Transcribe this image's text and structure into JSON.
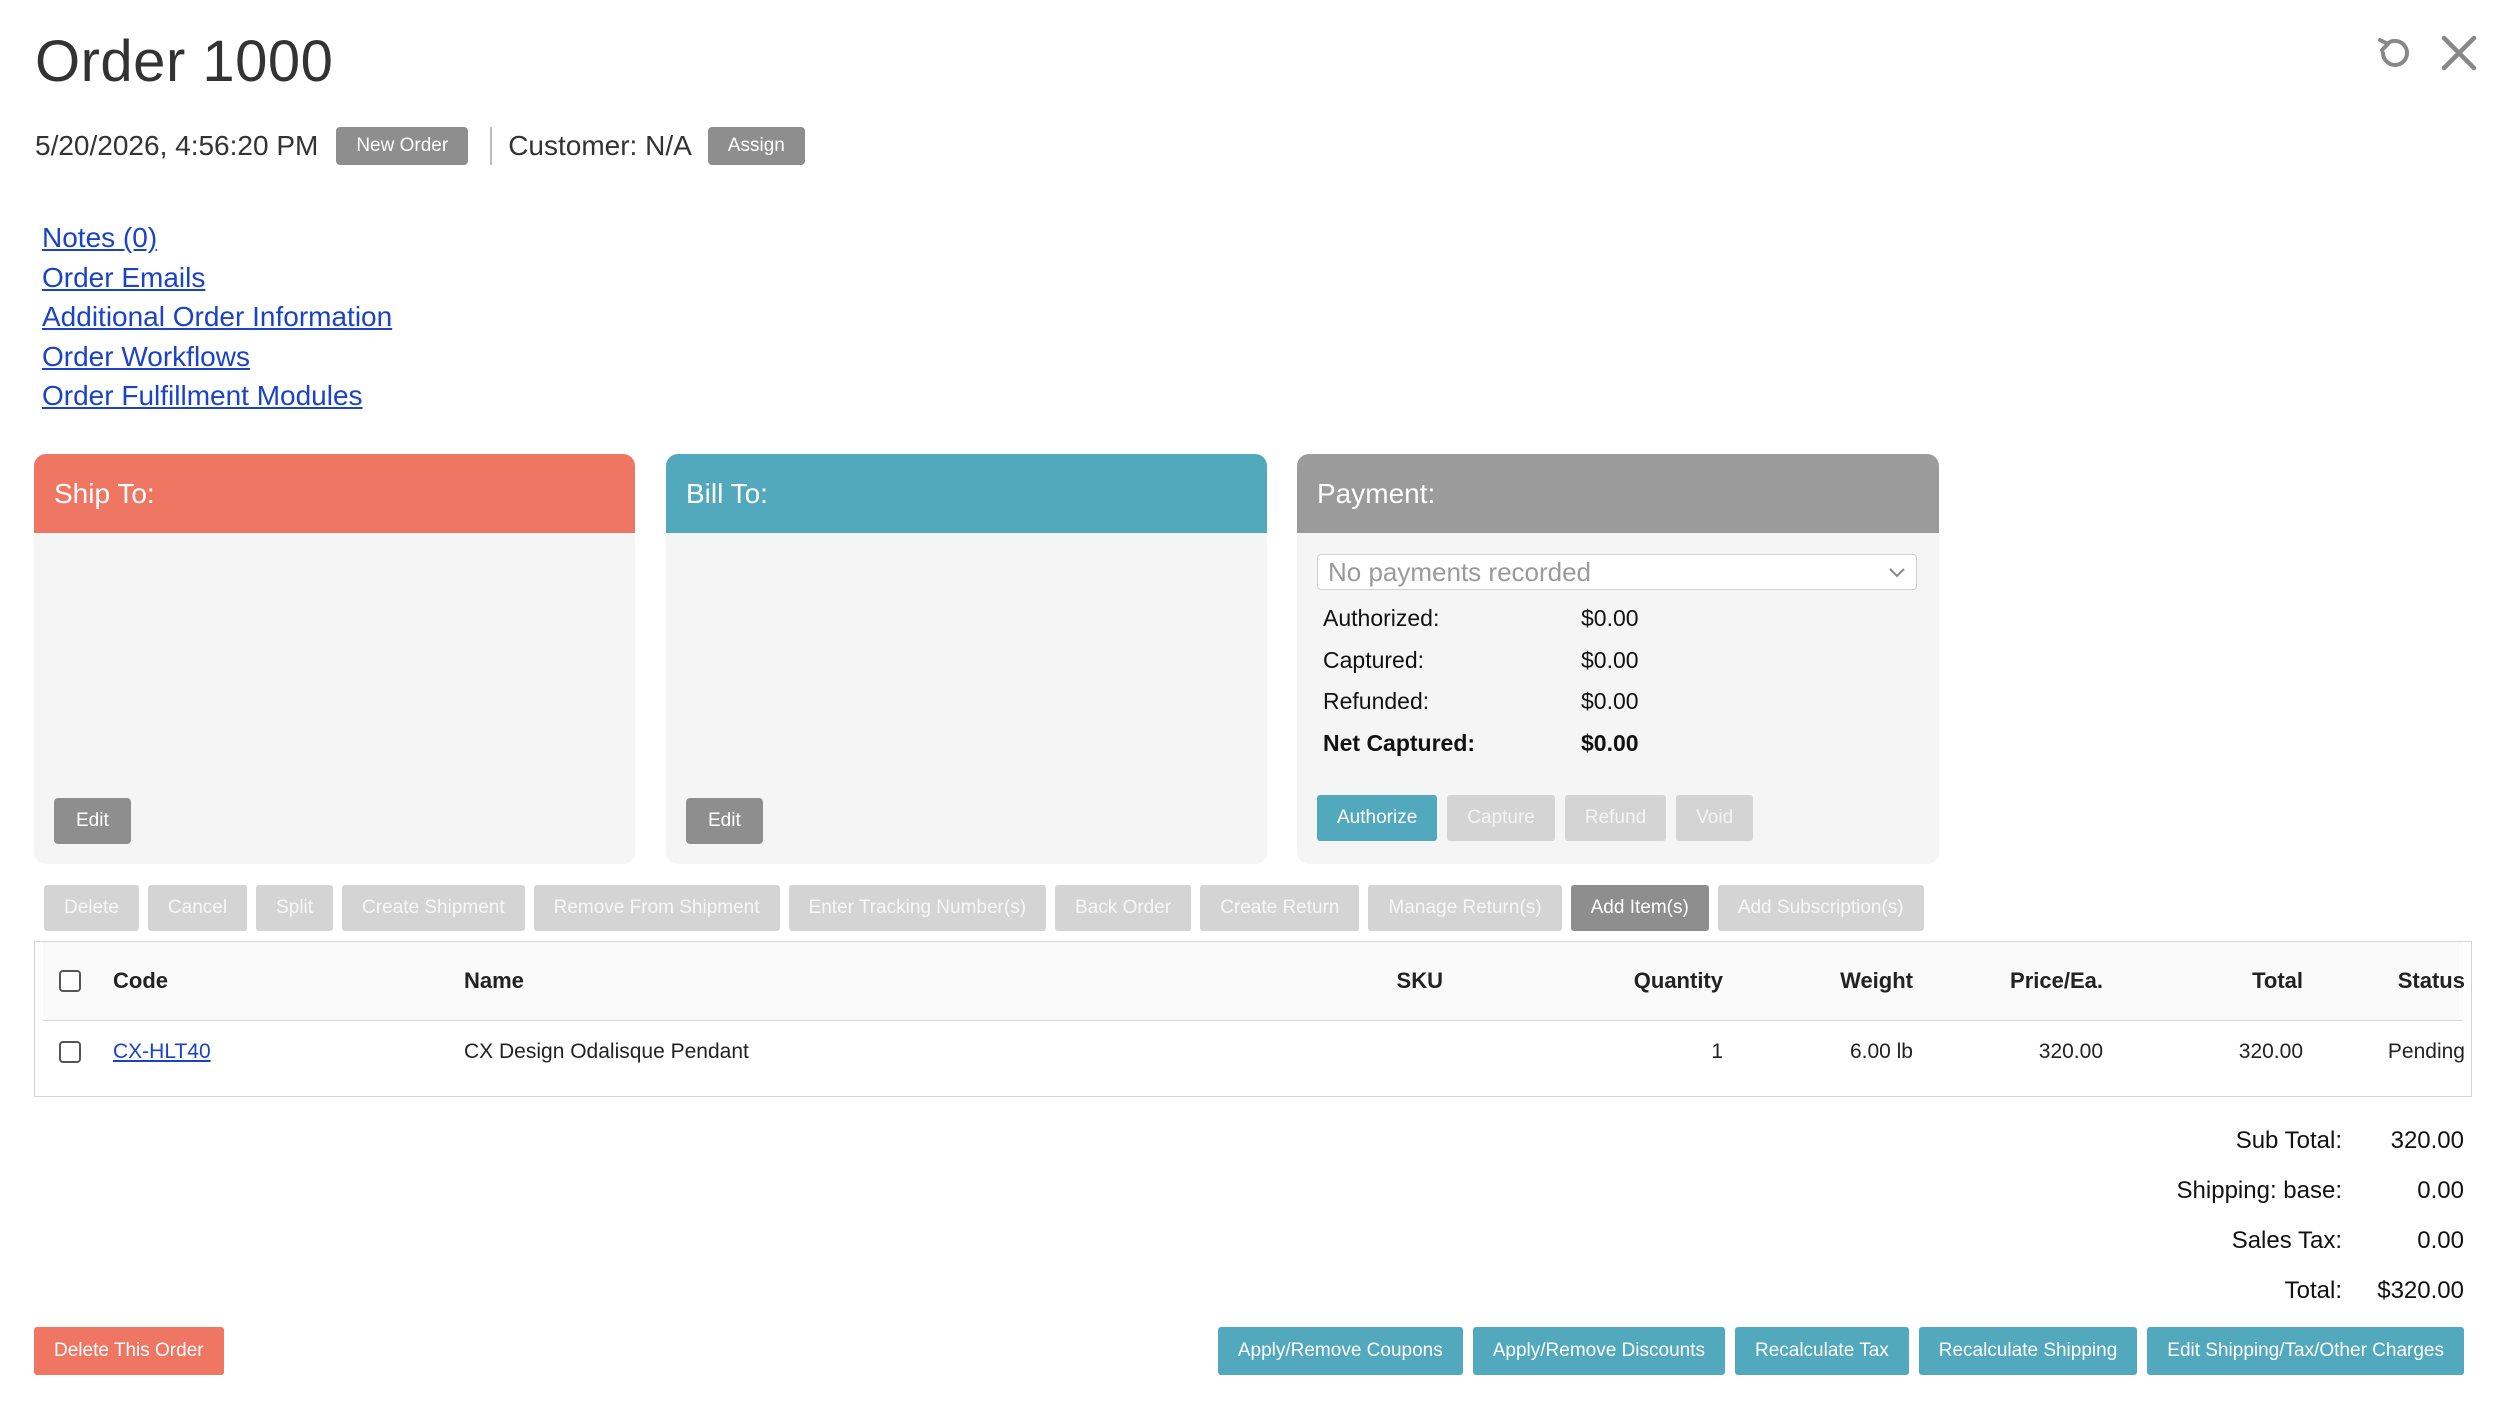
{
  "header": {
    "title": "Order 1000",
    "datetime": "5/20/2026, 4:56:20 PM",
    "new_order_label": "New Order",
    "customer_text": "Customer: N/A",
    "assign_label": "Assign",
    "icons": {
      "refresh": "refresh-icon",
      "close": "close-icon"
    }
  },
  "links": [
    "Notes (0)",
    "Order Emails",
    "Additional Order Information",
    "Order Workflows",
    "Order Fulfillment Modules"
  ],
  "ship_to": {
    "title": "Ship To:",
    "edit_label": "Edit",
    "color": "#ee7662"
  },
  "bill_to": {
    "title": "Bill To:",
    "edit_label": "Edit",
    "color": "#52a8bd"
  },
  "payment": {
    "title": "Payment:",
    "select_placeholder": "No payments recorded",
    "rows": [
      {
        "label": "Authorized:",
        "value": "$0.00"
      },
      {
        "label": "Captured:",
        "value": "$0.00"
      },
      {
        "label": "Refunded:",
        "value": "$0.00"
      },
      {
        "label": "Net Captured:",
        "value": "$0.00"
      }
    ],
    "buttons": [
      "Authorize",
      "Capture",
      "Refund",
      "Void"
    ]
  },
  "actions": [
    "Delete",
    "Cancel",
    "Split",
    "Create Shipment",
    "Remove From Shipment",
    "Enter Tracking Number(s)",
    "Back Order",
    "Create Return",
    "Manage Return(s)",
    "Add Item(s)",
    "Add Subscription(s)"
  ],
  "table": {
    "columns": [
      "Code",
      "Name",
      "SKU",
      "Quantity",
      "Weight",
      "Price/Ea.",
      "Total",
      "Status"
    ],
    "rows": [
      {
        "code": "CX-HLT40",
        "name": "CX Design Odalisque Pendant",
        "sku": "",
        "quantity": "1",
        "weight": "6.00 lb",
        "price": "320.00",
        "total": "320.00",
        "status": "Pending"
      }
    ]
  },
  "totals": [
    {
      "label": "Sub Total:",
      "value": "320.00"
    },
    {
      "label": "Shipping: base:",
      "value": "0.00"
    },
    {
      "label": "Sales Tax:",
      "value": "0.00"
    },
    {
      "label": "Total:",
      "value": "$320.00"
    }
  ],
  "footer": {
    "delete_order_label": "Delete This Order",
    "buttons": [
      "Apply/Remove Coupons",
      "Apply/Remove Discounts",
      "Recalculate Tax",
      "Recalculate Shipping",
      "Edit Shipping/Tax/Other Charges"
    ]
  },
  "colors": {
    "coral": "#ee7662",
    "teal": "#52a8bd",
    "gray": "#8e8e8e",
    "link": "#1a43c7"
  }
}
